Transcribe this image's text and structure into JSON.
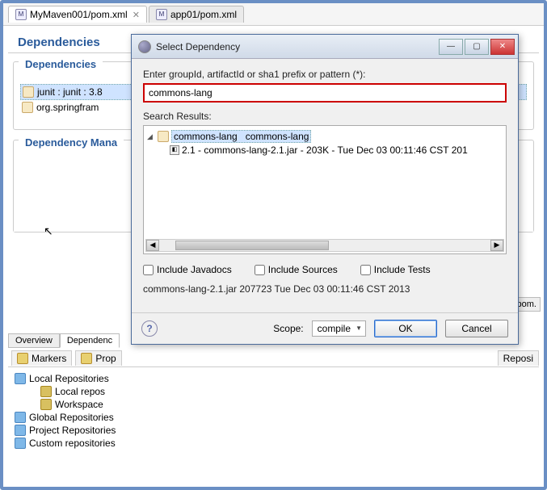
{
  "tabs": {
    "active": {
      "label": "MyMaven001/pom.xml"
    },
    "inactive": {
      "label": "app01/pom.xml"
    }
  },
  "section_title": "Dependencies",
  "groups": {
    "deps": {
      "title": "Dependencies",
      "items": [
        {
          "text": "junit : junit : 3.8"
        },
        {
          "text": "org.springfram"
        }
      ]
    },
    "dep_mgmt": {
      "title": "Dependency Mana"
    }
  },
  "bottom_tabs": {
    "overview": "Overview",
    "dependencies": "Dependenc"
  },
  "right_tabs": {
    "pom_ml": "pom.",
    "pom_ml2": "pom."
  },
  "views": {
    "markers": "Markers",
    "prop": "Prop",
    "reposi": "Reposi",
    "tree": {
      "local_repositories": "Local Repositories",
      "local_repos": "Local repos",
      "workspace": "Workspace",
      "global_repositories": "Global Repositories",
      "project_repositories": "Project Repositories",
      "custom_repositories": "Custom repositories"
    }
  },
  "dialog": {
    "title": "Select Dependency",
    "prompt": "Enter groupId, artifactId or sha1 prefix or pattern (*):",
    "input_value": "commons-lang",
    "results_label": "Search Results:",
    "result_group": "commons-lang",
    "result_artifact": "commons-lang",
    "result_version_line": "2.1 - commons-lang-2.1.jar - 203K - Tue Dec 03 00:11:46 CST 201",
    "chk_javadocs": "Include Javadocs",
    "chk_sources": "Include Sources",
    "chk_tests": "Include Tests",
    "info": "commons-lang-2.1.jar 207723 Tue Dec 03 00:11:46 CST 2013",
    "scope_label": "Scope:",
    "scope_value": "compile",
    "ok": "OK",
    "cancel": "Cancel"
  }
}
